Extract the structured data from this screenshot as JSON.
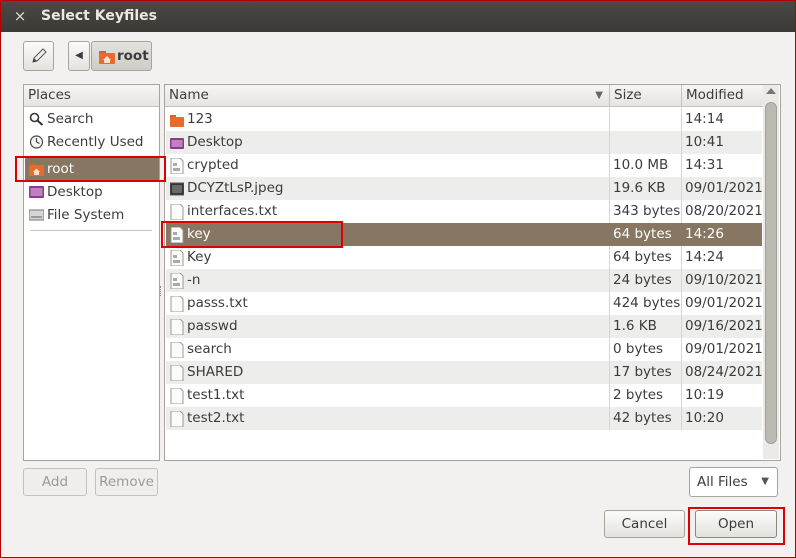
{
  "window": {
    "title": "Select Keyfiles",
    "close_glyph": "×"
  },
  "path_bar": {
    "edit_icon": "pencil-icon",
    "back_glyph": "◀",
    "current": "root"
  },
  "places": {
    "header": "Places",
    "items": [
      {
        "label": "Search",
        "icon": "search-icon"
      },
      {
        "label": "Recently Used",
        "icon": "clock-icon"
      },
      {
        "label": "root",
        "icon": "home-folder-icon"
      },
      {
        "label": "Desktop",
        "icon": "desktop-icon"
      },
      {
        "label": "File System",
        "icon": "drive-icon"
      }
    ],
    "selected": "root"
  },
  "files": {
    "columns": {
      "name": "Name",
      "size": "Size",
      "modified": "Modified",
      "sort_glyph": "▼"
    },
    "rows": [
      {
        "name": "123",
        "size": "",
        "modified": "14:14",
        "icon": "folder-icon"
      },
      {
        "name": "Desktop",
        "size": "",
        "modified": "10:41",
        "icon": "desktop-icon"
      },
      {
        "name": "crypted",
        "size": "10.0 MB",
        "modified": "14:31",
        "icon": "binary-file-icon"
      },
      {
        "name": "DCYZtLsP.jpeg",
        "size": "19.6 KB",
        "modified": "09/01/2021",
        "icon": "image-file-icon"
      },
      {
        "name": "interfaces.txt",
        "size": "343 bytes",
        "modified": "08/20/2021",
        "icon": "text-file-icon"
      },
      {
        "name": "key",
        "size": "64 bytes",
        "modified": "14:26",
        "icon": "binary-file-icon"
      },
      {
        "name": "Key",
        "size": "64 bytes",
        "modified": "14:24",
        "icon": "binary-file-icon"
      },
      {
        "name": "-n",
        "size": "24 bytes",
        "modified": "09/10/2021",
        "icon": "binary-file-icon"
      },
      {
        "name": "passs.txt",
        "size": "424 bytes",
        "modified": "09/01/2021",
        "icon": "text-file-icon"
      },
      {
        "name": "passwd",
        "size": "1.6 KB",
        "modified": "09/16/2021",
        "icon": "text-file-icon"
      },
      {
        "name": "search",
        "size": "0 bytes",
        "modified": "09/01/2021",
        "icon": "text-file-icon"
      },
      {
        "name": "SHARED",
        "size": "17 bytes",
        "modified": "08/24/2021",
        "icon": "text-file-icon"
      },
      {
        "name": "test1.txt",
        "size": "2 bytes",
        "modified": "10:19",
        "icon": "text-file-icon"
      },
      {
        "name": "test2.txt",
        "size": "42 bytes",
        "modified": "10:20",
        "icon": "text-file-icon"
      }
    ],
    "selected": "key"
  },
  "buttons": {
    "add": "Add",
    "remove": "Remove",
    "cancel": "Cancel",
    "open": "Open"
  },
  "filter": {
    "value": "All Files",
    "arrow": "▼"
  },
  "colors": {
    "selection": "#867662",
    "highlight_box": "#dd0000",
    "titlebar": "#3c3b37"
  }
}
